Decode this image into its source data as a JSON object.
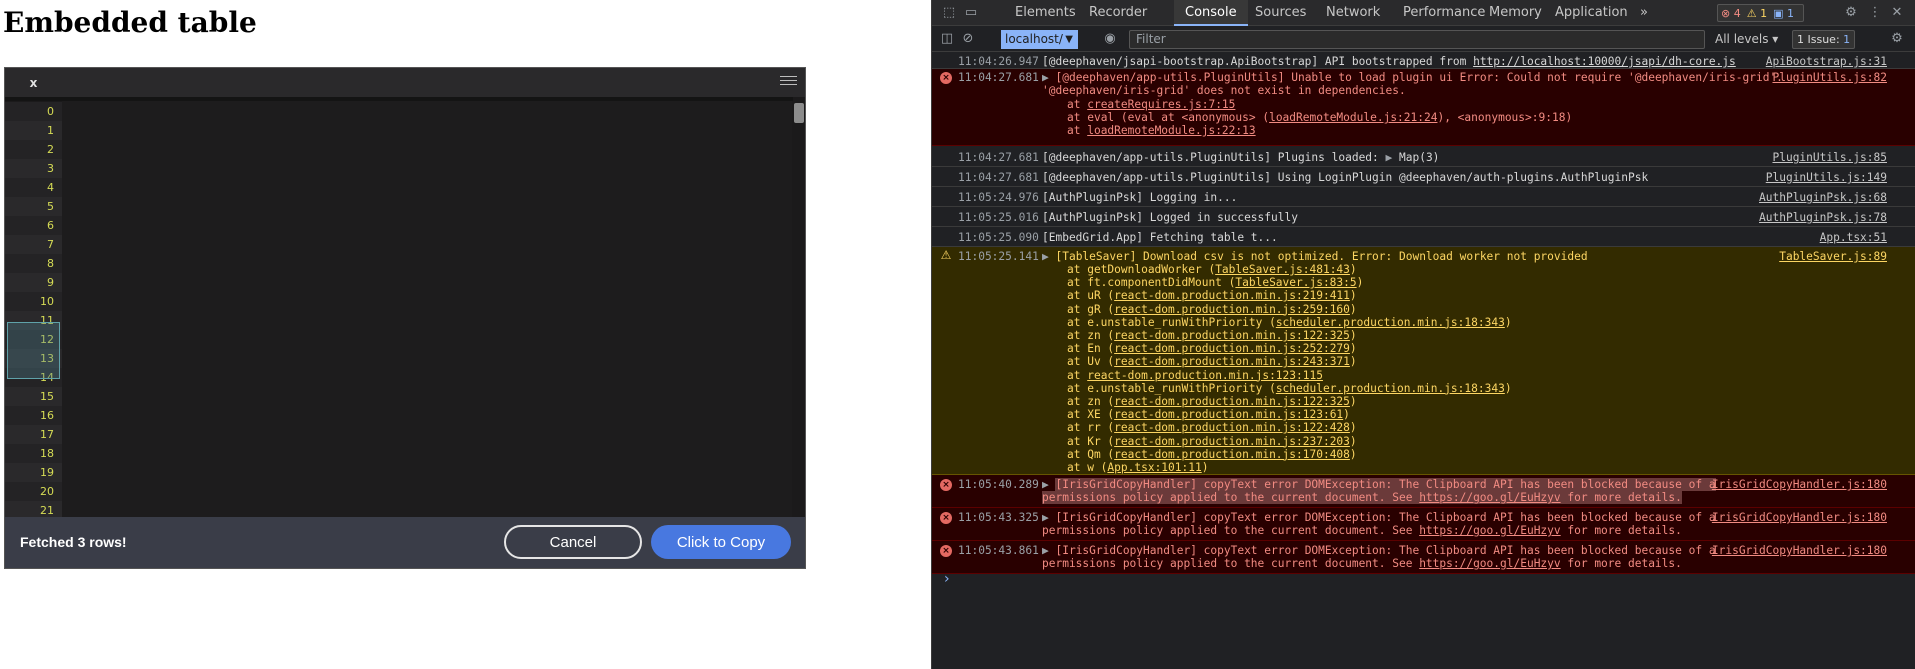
{
  "page": {
    "title": "Embedded table"
  },
  "grid": {
    "column_header": "x",
    "row_numbers": [
      "0",
      "1",
      "2",
      "3",
      "4",
      "5",
      "6",
      "7",
      "8",
      "9",
      "10",
      "11",
      "12",
      "13",
      "14",
      "15",
      "16",
      "17",
      "18",
      "19",
      "20",
      "21"
    ],
    "selected_rows": [
      "10",
      "11",
      "12"
    ],
    "copy_bar": {
      "status": "Fetched 3 rows!",
      "cancel_label": "Cancel",
      "copy_label": "Click to Copy"
    }
  },
  "devtools": {
    "tabs": [
      "Elements",
      "Recorder",
      "Console",
      "Sources",
      "Network",
      "Performance",
      "Memory",
      "Application"
    ],
    "active_tab": "Console",
    "more_tabs": "»",
    "badges": {
      "errors": "4",
      "warnings": "1",
      "info": "1"
    },
    "toolbar": {
      "context": "localhost/",
      "filter_placeholder": "Filter",
      "levels": "All levels",
      "issues": "1 Issue:",
      "issues_count": "1"
    },
    "console": {
      "m1": {
        "ts": "11:04:26.947",
        "text": "[@deephaven/jsapi-bootstrap.ApiBootstrap] API bootstrapped from ",
        "link": "http://localhost:10000/jsapi/dh-core.js",
        "src": "ApiBootstrap.js:31"
      },
      "m2": {
        "ts": "11:04:27.681",
        "line1": "[@deephaven/app-utils.PluginUtils] Unable to load plugin ui Error: Could not require '@deephaven/iris-grid'.",
        "line2": "'@deephaven/iris-grid' does not exist in dependencies.",
        "at1": "createRequires.js:7:15",
        "at2_pre": "eval (eval at <anonymous> (",
        "at2_link": "loadRemoteModule.js:21:24",
        "at2_post": "), <anonymous>:9:18)",
        "at3": "loadRemoteModule.js:22:13",
        "src": "PluginUtils.js:82"
      },
      "m3": {
        "ts": "11:04:27.681",
        "text": "[@deephaven/app-utils.PluginUtils] Plugins loaded: ",
        "map": "Map(3)",
        "src": "PluginUtils.js:85"
      },
      "m4": {
        "ts": "11:04:27.681",
        "text": "[@deephaven/app-utils.PluginUtils] Using LoginPlugin @deephaven/auth-plugins.AuthPluginPsk",
        "src": "PluginUtils.js:149"
      },
      "m5": {
        "ts": "11:05:24.976",
        "text": "[AuthPluginPsk] Logging in...",
        "src": "AuthPluginPsk.js:68"
      },
      "m6": {
        "ts": "11:05:25.016",
        "text": "[AuthPluginPsk] Logged in successfully",
        "src": "AuthPluginPsk.js:78"
      },
      "m7": {
        "ts": "11:05:25.090",
        "text": "[EmbedGrid.App] Fetching table t...",
        "src": "App.tsx:51"
      },
      "m8": {
        "ts": "11:05:25.141",
        "text": "[TableSaver] Download csv is not optimized. Error: Download worker not provided",
        "src": "TableSaver.js:89",
        "stack": [
          {
            "fn": "getDownloadWorker",
            "loc": "TableSaver.js:481:43"
          },
          {
            "fn": "ft.componentDidMount",
            "loc": "TableSaver.js:83:5"
          },
          {
            "fn": "uR",
            "loc": "react-dom.production.min.js:219:411"
          },
          {
            "fn": "gR",
            "loc": "react-dom.production.min.js:259:160"
          },
          {
            "fn": "e.unstable_runWithPriority",
            "loc": "scheduler.production.min.js:18:343"
          },
          {
            "fn": "zn",
            "loc": "react-dom.production.min.js:122:325"
          },
          {
            "fn": "En",
            "loc": "react-dom.production.min.js:252:279"
          },
          {
            "fn": "Uv",
            "loc": "react-dom.production.min.js:243:371"
          },
          {
            "fn": "",
            "loc": "react-dom.production.min.js:123:115"
          },
          {
            "fn": "e.unstable_runWithPriority",
            "loc": "scheduler.production.min.js:18:343"
          },
          {
            "fn": "zn",
            "loc": "react-dom.production.min.js:122:325"
          },
          {
            "fn": "XE",
            "loc": "react-dom.production.min.js:123:61"
          },
          {
            "fn": "rr",
            "loc": "react-dom.production.min.js:122:428"
          },
          {
            "fn": "Kr",
            "loc": "react-dom.production.min.js:237:203"
          },
          {
            "fn": "Qm",
            "loc": "react-dom.production.min.js:170:408"
          },
          {
            "fn": "w",
            "loc": "App.tsx:101:11"
          }
        ]
      },
      "m9": {
        "ts": "11:05:40.289",
        "line1": "[IrisGridCopyHandler] copyText error DOMException: The Clipboard API has been blocked because of a",
        "line2_pre": "permissions policy applied to the current document. See ",
        "link": "https://goo.gl/EuHzyv",
        "line2_post": " for more details.",
        "src": "IrisGridCopyHandler.js:180"
      },
      "m10": {
        "ts": "11:05:43.325",
        "line1": "[IrisGridCopyHandler] copyText error DOMException: The Clipboard API has been blocked because of a",
        "line2_pre": "permissions policy applied to the current document. See ",
        "link": "https://goo.gl/EuHzyv",
        "line2_post": " for more details.",
        "src": "IrisGridCopyHandler.js:180"
      },
      "m11": {
        "ts": "11:05:43.861",
        "line1": "[IrisGridCopyHandler] copyText error DOMException: The Clipboard API has been blocked because of a",
        "line2_pre": "permissions policy applied to the current document. See ",
        "link": "https://goo.gl/EuHzyv",
        "line2_post": " for more details.",
        "src": "IrisGridCopyHandler.js:180"
      }
    }
  }
}
